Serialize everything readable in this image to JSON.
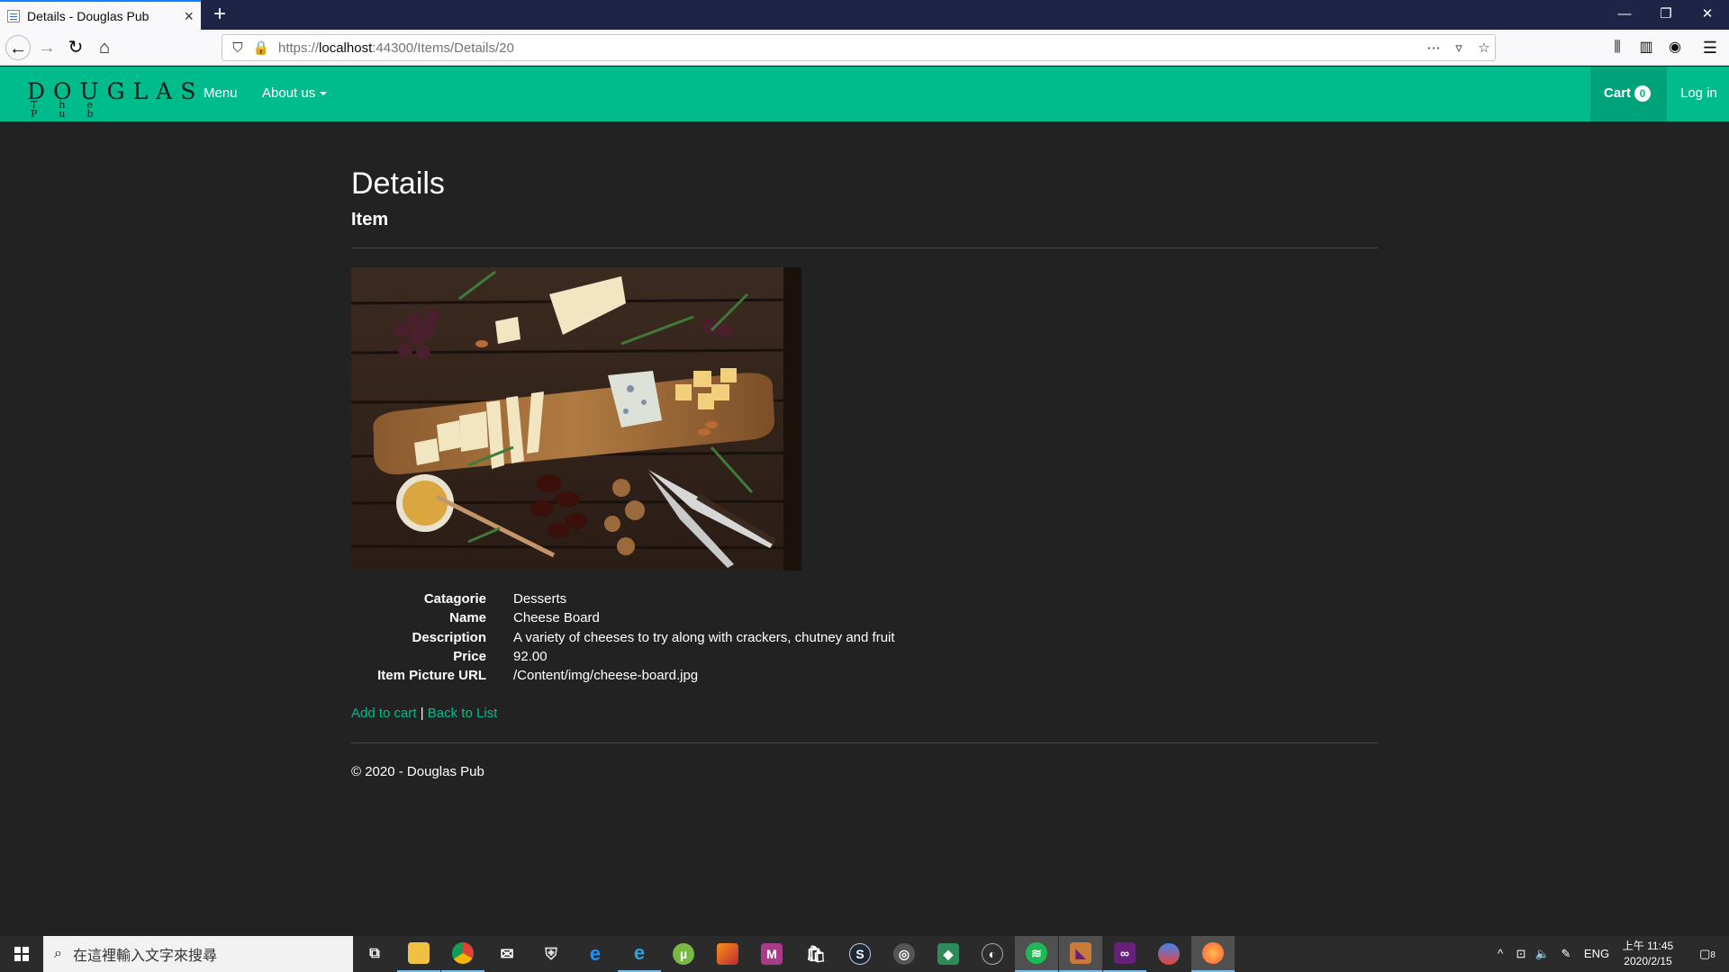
{
  "browser": {
    "tab_title": "Details - Douglas Pub",
    "url_prefix": "https://",
    "url_host": "localhost",
    "url_path": ":44300/Items/Details/20",
    "new_tab_label": "+"
  },
  "site": {
    "brand_big": "DOUGLAS",
    "brand_small": "The Pub",
    "nav": {
      "menu": "Menu",
      "about": "About us",
      "cart": "Cart",
      "cart_count": "0",
      "login": "Log in"
    }
  },
  "page": {
    "title": "Details",
    "subtitle": "Item",
    "fields": [
      {
        "label": "Catagorie",
        "value": "Desserts"
      },
      {
        "label": "Name",
        "value": "Cheese Board"
      },
      {
        "label": "Description",
        "value": "A variety of cheeses to try along with crackers, chutney and fruit"
      },
      {
        "label": "Price",
        "value": "92.00"
      },
      {
        "label": "Item Picture URL",
        "value": "/Content/img/cheese-board.jpg"
      }
    ],
    "actions": {
      "add_to_cart": "Add to cart",
      "separator": " | ",
      "back": "Back to List"
    },
    "footer": "© 2020 - Douglas Pub"
  },
  "taskbar": {
    "search_placeholder": "在這裡輸入文字來搜尋",
    "tray_lang": "ENG",
    "clock_time": "上午 11:45",
    "clock_date": "2020/2/15",
    "notification_count": "8",
    "apps": [
      "task-view",
      "file-explorer",
      "chrome",
      "mail",
      "defender",
      "edge",
      "internet-explorer",
      "utorrent",
      "matlab",
      "m-app",
      "store",
      "steam",
      "obs-like",
      "green-cube",
      "obs",
      "spotify",
      "visual-studio-purple",
      "visual-studio",
      "maps",
      "firefox"
    ]
  },
  "colors": {
    "accent": "#00bc8c",
    "background": "#222222",
    "browser_tabbar": "#1d2445"
  }
}
